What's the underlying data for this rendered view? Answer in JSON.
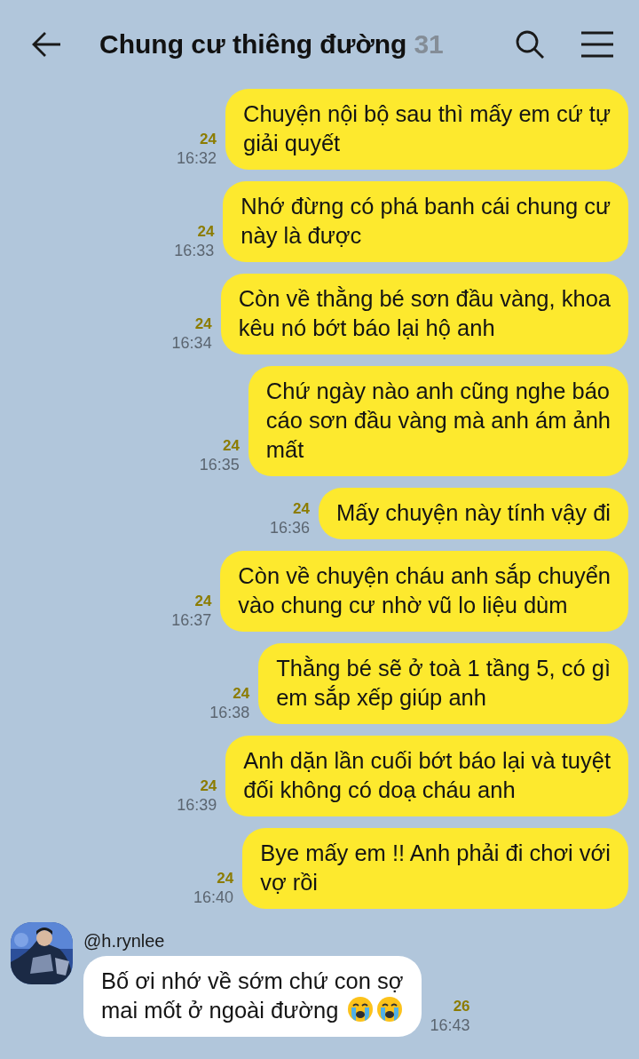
{
  "header": {
    "title": "Chung cư thiêng đường",
    "member_count": "31"
  },
  "messages": [
    {
      "kind": "outgoing",
      "text": "Chuyện nội bộ sau thì mấy em cứ tự\ngiải quyết",
      "read_count": "24",
      "time": "16:32"
    },
    {
      "kind": "outgoing",
      "text": "Nhớ đừng có phá banh cái chung cư\nnày là được",
      "read_count": "24",
      "time": "16:33"
    },
    {
      "kind": "outgoing",
      "text": "Còn về thằng bé sơn đầu vàng, khoa\nkêu nó bớt báo lại hộ anh",
      "read_count": "24",
      "time": "16:34"
    },
    {
      "kind": "outgoing",
      "text": "Chứ ngày nào anh cũng nghe báo\ncáo sơn đầu vàng mà anh ám ảnh\nmất",
      "read_count": "24",
      "time": "16:35"
    },
    {
      "kind": "outgoing",
      "text": "Mấy chuyện này tính vậy đi",
      "read_count": "24",
      "time": "16:36"
    },
    {
      "kind": "outgoing",
      "text": "Còn về chuyện cháu anh sắp chuyển\nvào chung cư nhờ vũ lo liệu dùm",
      "read_count": "24",
      "time": "16:37"
    },
    {
      "kind": "outgoing",
      "text": "Thằng bé sẽ ở toà 1 tầng 5, có gì\nem sắp xếp giúp anh",
      "read_count": "24",
      "time": "16:38"
    },
    {
      "kind": "outgoing",
      "text": "Anh dặn lần cuối bớt báo lại và tuyệt\nđối không có doạ cháu anh",
      "read_count": "24",
      "time": "16:39"
    },
    {
      "kind": "outgoing",
      "text": "Bye mấy em !! Anh phải đi chơi với\nvợ rồi",
      "read_count": "24",
      "time": "16:40"
    },
    {
      "kind": "incoming",
      "sender": "@h.rynlee",
      "text": "Bố ơi nhớ về sớm chứ con sợ\nmai mốt ở ngoài đường",
      "emojis": [
        {
          "kind": "crying"
        },
        {
          "kind": "crying"
        }
      ],
      "read_count": "26",
      "time": "16:43"
    }
  ]
}
